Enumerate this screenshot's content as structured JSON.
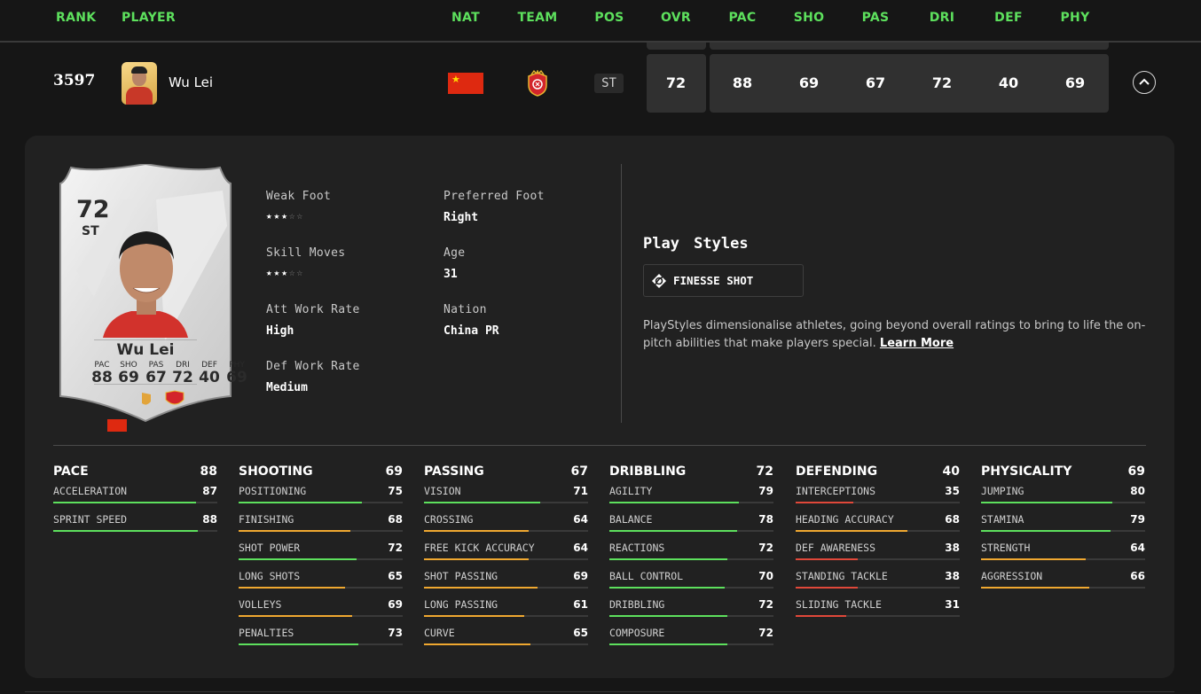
{
  "colors": {
    "green": "#5de05d",
    "orange": "#f0a830",
    "red": "#e0483a"
  },
  "header": {
    "rank": "RANK",
    "player": "PLAYER",
    "nat": "NAT",
    "team": "TEAM",
    "pos": "POS",
    "ovr": "OVR",
    "pac": "PAC",
    "sho": "SHO",
    "pas": "PAS",
    "dri": "DRI",
    "def": "DEF",
    "phy": "PHY"
  },
  "row": {
    "rank": "3597",
    "name": "Wu Lei",
    "nation_icon": "china-flag",
    "team_icon": "shanghai-port-crest",
    "pos": "ST",
    "ovr": "72",
    "pac": "88",
    "sho": "69",
    "pas": "67",
    "dri": "72",
    "def": "40",
    "phy": "69",
    "toggle_icon": "chevron-up-icon"
  },
  "card": {
    "ovr": "72",
    "pos": "ST",
    "name": "Wu Lei",
    "stats": [
      {
        "label": "PAC",
        "value": "88"
      },
      {
        "label": "SHO",
        "value": "69"
      },
      {
        "label": "PAS",
        "value": "67"
      },
      {
        "label": "DRI",
        "value": "72"
      },
      {
        "label": "DEF",
        "value": "40"
      },
      {
        "label": "PHY",
        "value": "69"
      }
    ]
  },
  "info": {
    "weak_foot": {
      "label": "Weak Foot",
      "stars": 3,
      "max": 5
    },
    "skill_moves": {
      "label": "Skill Moves",
      "stars": 3,
      "max": 5
    },
    "att_work_rate": {
      "label": "Att Work Rate",
      "value": "High"
    },
    "def_work_rate": {
      "label": "Def Work Rate",
      "value": "Medium"
    },
    "preferred_foot": {
      "label": "Preferred Foot",
      "value": "Right"
    },
    "age": {
      "label": "Age",
      "value": "31"
    },
    "nation": {
      "label": "Nation",
      "value": "China PR"
    }
  },
  "playstyles": {
    "title": "Play Styles",
    "items": [
      {
        "name": "FINESSE SHOT",
        "icon": "finesse-shot-icon"
      }
    ],
    "description": "PlayStyles dimensionalise athletes, going beyond overall ratings to bring to life the on-pitch abilities that make players special.",
    "link": "Learn More"
  },
  "stats": [
    {
      "name": "PACE",
      "value": "88",
      "attrs": [
        {
          "name": "ACCELERATION",
          "value": "87"
        },
        {
          "name": "SPRINT SPEED",
          "value": "88"
        }
      ]
    },
    {
      "name": "SHOOTING",
      "value": "69",
      "attrs": [
        {
          "name": "POSITIONING",
          "value": "75"
        },
        {
          "name": "FINISHING",
          "value": "68"
        },
        {
          "name": "SHOT POWER",
          "value": "72"
        },
        {
          "name": "LONG SHOTS",
          "value": "65"
        },
        {
          "name": "VOLLEYS",
          "value": "69"
        },
        {
          "name": "PENALTIES",
          "value": "73"
        }
      ]
    },
    {
      "name": "PASSING",
      "value": "67",
      "attrs": [
        {
          "name": "VISION",
          "value": "71"
        },
        {
          "name": "CROSSING",
          "value": "64"
        },
        {
          "name": "FREE KICK ACCURACY",
          "value": "64"
        },
        {
          "name": "SHOT PASSING",
          "value": "69"
        },
        {
          "name": "LONG PASSING",
          "value": "61"
        },
        {
          "name": "CURVE",
          "value": "65"
        }
      ]
    },
    {
      "name": "DRIBBLING",
      "value": "72",
      "attrs": [
        {
          "name": "AGILITY",
          "value": "79"
        },
        {
          "name": "BALANCE",
          "value": "78"
        },
        {
          "name": "REACTIONS",
          "value": "72"
        },
        {
          "name": "BALL CONTROL",
          "value": "70"
        },
        {
          "name": "DRIBBLING",
          "value": "72"
        },
        {
          "name": "COMPOSURE",
          "value": "72"
        }
      ]
    },
    {
      "name": "DEFENDING",
      "value": "40",
      "attrs": [
        {
          "name": "INTERCEPTIONS",
          "value": "35"
        },
        {
          "name": "HEADING ACCURACY",
          "value": "68"
        },
        {
          "name": "DEF AWARENESS",
          "value": "38"
        },
        {
          "name": "STANDING TACKLE",
          "value": "38"
        },
        {
          "name": "SLIDING TACKLE",
          "value": "31"
        }
      ]
    },
    {
      "name": "PHYSICALITY",
      "value": "69",
      "attrs": [
        {
          "name": "JUMPING",
          "value": "80"
        },
        {
          "name": "STAMINA",
          "value": "79"
        },
        {
          "name": "STRENGTH",
          "value": "64"
        },
        {
          "name": "AGGRESSION",
          "value": "66"
        }
      ]
    }
  ]
}
